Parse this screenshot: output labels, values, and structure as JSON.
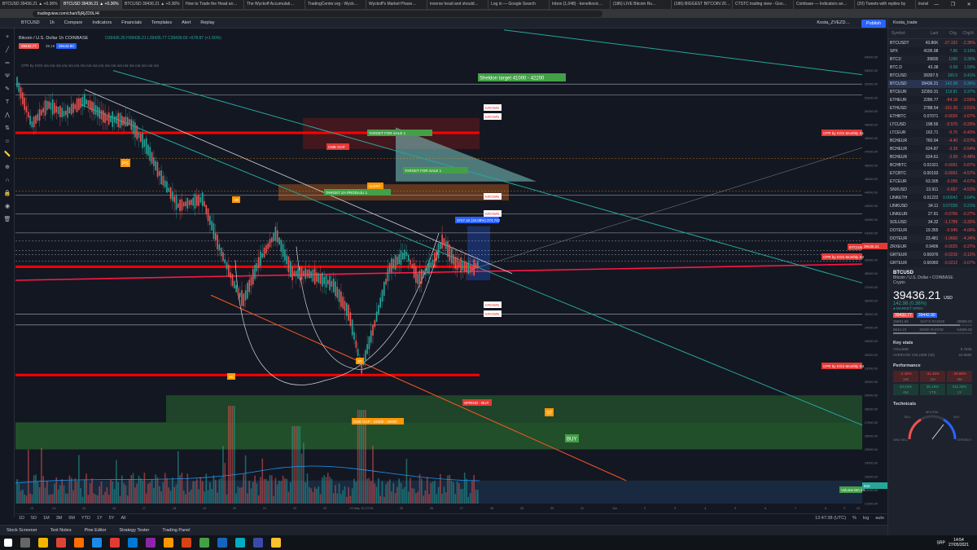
{
  "browser": {
    "tabs": [
      "BTCUSD 39436.21 ▲ +0.36%",
      "BTCUSD 39436.21 ▲ +0.36%",
      "BTCUSD 39436.21 ▲ +0.36%",
      "How to Trade the Head an…",
      "The Wyckoff Accumulati…",
      "TradingCenter.org - Wyck…",
      "Wyckoff's Market Phase…",
      "inverse head and should…",
      "Log in — Google Search",
      "Inbox (1,048) - kenelkovic…",
      "(186) LIVE Bitcoin Ru…",
      "(186) BIGGEST BITCOIN 20…",
      "CTSTC trading view - Goo…",
      "Coinbase — Indicators an…",
      "(20) Tweets with replies by",
      "translate - Google prevod…"
    ],
    "url": "tradingview.com/chart/5jRjZD9L/4/",
    "controls": [
      "—",
      "❐",
      "✕"
    ]
  },
  "tv_header": {
    "symbol": "BTCUSD",
    "interval": "1h",
    "buttons": [
      "Compare",
      "Indicators",
      "Financials",
      "Templates",
      "Alert",
      "Replay"
    ],
    "layout_name": "Kosta_ZVEZD…",
    "publish": "Publish"
  },
  "timeframes": [
    "1m",
    "5m",
    "15m",
    "30m",
    "45m",
    "1h",
    "2h",
    "3h",
    "4h",
    "6h",
    "12h",
    "1D",
    "2D",
    "3D",
    "1W",
    "2M",
    "4M",
    "1M",
    "2M",
    "4M"
  ],
  "chart": {
    "symbol_line": "Bitcoin / U.S. Dollar  1h  COINBASE",
    "ohlc": "O39436.35 H39436.21 L39435.77 C39439.00 +578.87 (+1.60%)",
    "price_box_left": "39432.77",
    "price_box_mid": "39.19",
    "price_box_right": "39442.90",
    "indicator_line": "CPR by KGS  n/a n/a n/a n/a n/a n/a n/a n/a n/a n/a n/a n/a n/a n/a n/a n/a n/a n/a n/a",
    "annotations": {
      "sheldon": "Sheldon target 41000 - 42200",
      "target_for_sale_top": "TARGET FOR SALE 1",
      "target_for_sale_mid": "TARGET FOR SALE 1",
      "cme_gap_top": "CME GAP",
      "alert": "ALERT",
      "target_za_prodaju": "TARGET ZA PRODAJU 1",
      "cme_gap_bottom": "CME GAP - 24000 - 26000",
      "spring_buy": "SPRING - BUY",
      "st": "ST",
      "buy": "BUY",
      "ps": "PS",
      "ar": "AR",
      "sc": "SC",
      "st2": "ST",
      "krown": "KROWN",
      "cpr_monthly_s1": "CPR by KGS Monthly S1",
      "cpr_monthly_s2": "CPR by KGS Monthly S2",
      "cpr_monthly_s3": "CPR by KGS Monthly S3",
      "measure": "3747.42 (10.08%) 374.742",
      "vol_label": "Volume MA 20",
      "vol_val": "842",
      "btcusd_tag": "BTCUSD",
      "btcusd_price_tag": "39436.21"
    },
    "price_scale": [
      "54000.00",
      "53000.00",
      "52000.00",
      "51000.00",
      "50000.00",
      "49000.00",
      "48000.00",
      "47000.00",
      "46000.00",
      "45000.00",
      "44000.00",
      "43000.00",
      "42000.00",
      "41000.00",
      "40000.00",
      "39000.00",
      "38000.00",
      "37000.00",
      "36000.00",
      "35000.00",
      "34000.00",
      "33000.00",
      "32000.00",
      "31000.00",
      "30000.00",
      "29000.00",
      "28000.00",
      "27000.00",
      "26000.00",
      "25000.00",
      "24000.00",
      "23000.00",
      "22000.00",
      "21000.00"
    ],
    "time_scale": [
      "13",
      "14",
      "15",
      "16",
      "17",
      "18",
      "19",
      "20",
      "21",
      "22",
      "23",
      "24 May '21  07:00",
      "25",
      "26",
      "27",
      "28",
      "29",
      "30",
      "31",
      "Jun",
      "2",
      "3",
      "4",
      "5",
      "6",
      "7",
      "8",
      "9",
      "10"
    ]
  },
  "bottom": {
    "ranges": [
      "1D",
      "5D",
      "1M",
      "3M",
      "6M",
      "YTD",
      "1Y",
      "5Y",
      "All"
    ],
    "clock": "12:47:38 (UTC)",
    "scale_opts": [
      "%",
      "log",
      "auto"
    ],
    "tabs": [
      "Stock Screener",
      "Text Notes",
      "Pine Editor",
      "Strategy Tester",
      "Trading Panel"
    ]
  },
  "taskbar": {
    "time": "14:54",
    "date": "27/05/2021",
    "lang": "SRP"
  },
  "watchlist": {
    "user": "Kosta_trade",
    "headers": [
      "Symbol",
      "Last",
      "Chg",
      "Chg%"
    ],
    "rows": [
      {
        "sym": "BTCUSDT",
        "last": "43.86K",
        "chg": "-27.332",
        "pct": "-2.35%",
        "neg": true
      },
      {
        "sym": "SPX",
        "last": "4195.98",
        "chg": "7.86",
        "pct": "0.19%",
        "neg": false
      },
      {
        "sym": "BTC1!",
        "last": "39835",
        "chg": "1290",
        "pct": "3.35%",
        "neg": false
      },
      {
        "sym": "BTC.D",
        "last": "43.38",
        "chg": "0.68",
        "pct": "1.59%",
        "neg": false
      },
      {
        "sym": "BTCUSD",
        "last": "39397.5",
        "chg": "160.5",
        "pct": "0.41%",
        "neg": false
      },
      {
        "sym": "BTCUSD",
        "last": "39436.21",
        "chg": "142.98",
        "pct": "0.36%",
        "neg": false
      },
      {
        "sym": "BTCEUR",
        "last": "32350.31",
        "chg": "119.81",
        "pct": "0.37%",
        "neg": false
      },
      {
        "sym": "ETHEUR",
        "last": "2286.77",
        "chg": "-84.16",
        "pct": "-3.55%",
        "neg": true
      },
      {
        "sym": "ETHUSD",
        "last": "2788.54",
        "chg": "-101.30",
        "pct": "-3.51%",
        "neg": true
      },
      {
        "sym": "ETHBTC",
        "last": "0.07071",
        "chg": "-0.0026",
        "pct": "-3.67%",
        "neg": true
      },
      {
        "sym": "LTCUSD",
        "last": "198.56",
        "chg": "-0.570",
        "pct": "-0.29%",
        "neg": true
      },
      {
        "sym": "LTCEUR",
        "last": "162.71",
        "chg": "-0.70",
        "pct": "-0.43%",
        "neg": true
      },
      {
        "sym": "BCHEUR",
        "last": "760.94",
        "chg": "-4.40",
        "pct": "-0.57%",
        "neg": true
      },
      {
        "sym": "BCHEUR",
        "last": "624.87",
        "chg": "-3.39",
        "pct": "-0.54%",
        "neg": true
      },
      {
        "sym": "BCHEUR",
        "last": "624.61",
        "chg": "-2.99",
        "pct": "-0.48%",
        "neg": true
      },
      {
        "sym": "BCHBTC",
        "last": "0.01921",
        "chg": "-0.0001",
        "pct": "-0.87%",
        "neg": true
      },
      {
        "sym": "ETCBTC",
        "last": "0.00193",
        "chg": "-0.0001",
        "pct": "-4.57%",
        "neg": true
      },
      {
        "sym": "ETCEUR",
        "last": "63.305",
        "chg": "-3.055",
        "pct": "-4.67%",
        "neg": true
      },
      {
        "sym": "SNXUSD",
        "last": "13.911",
        "chg": "-0.657",
        "pct": "-4.51%",
        "neg": true
      },
      {
        "sym": "LINKETH",
        "last": "0.01222",
        "chg": "0.00042",
        "pct": "3.64%",
        "neg": false
      },
      {
        "sym": "LINKUSD",
        "last": "34.11",
        "chg": "0.07036",
        "pct": "0.21%",
        "neg": false
      },
      {
        "sym": "LINKEUR",
        "last": "27.81",
        "chg": "-0.0766",
        "pct": "-0.27%",
        "neg": true
      },
      {
        "sym": "SOLUSD",
        "last": "34.32",
        "chg": "-1.1789",
        "pct": "-3.32%",
        "neg": true
      },
      {
        "sym": "DOTEUR",
        "last": "19.355",
        "chg": "-0.945",
        "pct": "-4.66%",
        "neg": true
      },
      {
        "sym": "DOTEUR",
        "last": "23.481",
        "chg": "-1.0660",
        "pct": "-4.34%",
        "neg": true
      },
      {
        "sym": "ZRXEUR",
        "last": "0.9406",
        "chg": "-0.0025",
        "pct": "-0.27%",
        "neg": true
      },
      {
        "sym": "GRTEUR",
        "last": "0.66976",
        "chg": "-0.0215",
        "pct": "-3.12%",
        "neg": true
      },
      {
        "sym": "GRTEUR",
        "last": "0.66960",
        "chg": "-0.0212",
        "pct": "-3.07%",
        "neg": true
      }
    ]
  },
  "details": {
    "symbol": "BTCUSD",
    "name": "Bitcoin / U.S. Dollar",
    "exchange": "COINBASE",
    "type": "Crypto",
    "price": "39436.21",
    "currency": "USD",
    "change": "142.98 (0.36%)",
    "status": "● MARKET OPEN",
    "bid": "39432.77",
    "ask": "39442.90",
    "day_low": "35991.99",
    "day_high": "39999.00",
    "day_label": "DAY'S RANGE",
    "wk_low": "8644.23",
    "wk_high": "64899.00",
    "wk_label": "52WK RANGE",
    "key_stats": "Key stats",
    "volume_label": "VOLUME",
    "volume": "9.793K",
    "avg_volume_label": "AVERAGE VOLUME (30)",
    "avg_volume": "42.666K",
    "performance": "Performance",
    "perf": [
      {
        "v": "-2.42%",
        "l": "1W"
      },
      {
        "v": "-31.46%",
        "l": "1M"
      },
      {
        "v": "-28.98%",
        "l": "3M"
      },
      {
        "v": "33.44%",
        "l": "6M"
      },
      {
        "v": "35.18%",
        "l": "YTD"
      },
      {
        "v": "311.26%",
        "l": "1Y"
      }
    ],
    "technicals": "Technicals",
    "gauge_labels": [
      "STRONG SELL",
      "SELL",
      "NEUTRAL",
      "BUY",
      "STRONG BUY"
    ]
  },
  "colors": {
    "bg": "#131722",
    "up": "#26a69a",
    "down": "#ef5350",
    "red_line": "#ff0000",
    "green_zone": "#4caf50",
    "accent": "#2962ff"
  }
}
